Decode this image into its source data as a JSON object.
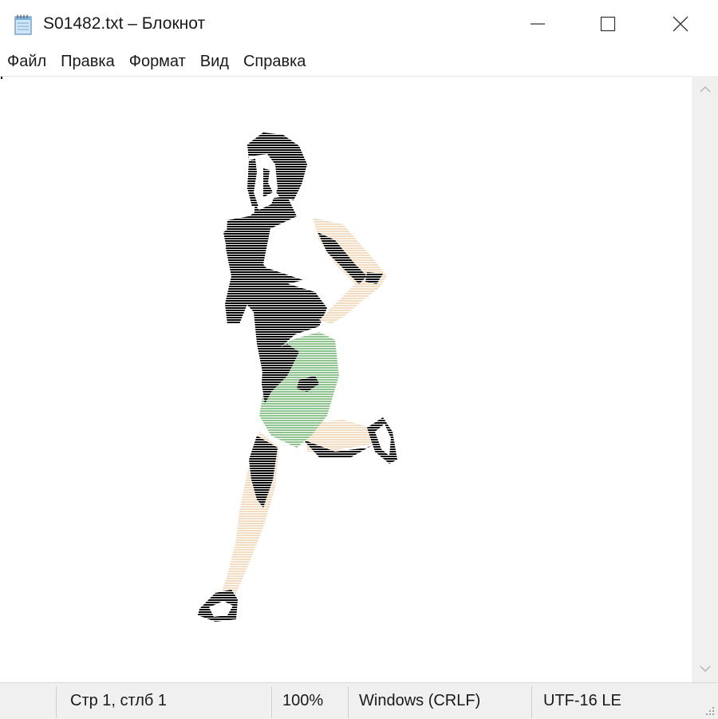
{
  "window": {
    "title": "S01482.txt – Блокнот",
    "controls": {
      "minimize_icon": "minimize-icon",
      "maximize_icon": "maximize-icon",
      "close_icon": "close-icon"
    }
  },
  "menu": {
    "items": [
      {
        "label": "Файл"
      },
      {
        "label": "Правка"
      },
      {
        "label": "Формат"
      },
      {
        "label": "Вид"
      },
      {
        "label": "Справка"
      }
    ]
  },
  "editor": {
    "content_description_icon": "running-man-ascii-art",
    "colors": {
      "skin": "#f2dcc2",
      "shorts": "#8fc48f",
      "ink": "#000000",
      "shirt": "#ffffff"
    }
  },
  "statusbar": {
    "position": "Стр 1, стлб 1",
    "zoom": "100%",
    "line_ending": "Windows (CRLF)",
    "encoding": "UTF-16 LE"
  }
}
